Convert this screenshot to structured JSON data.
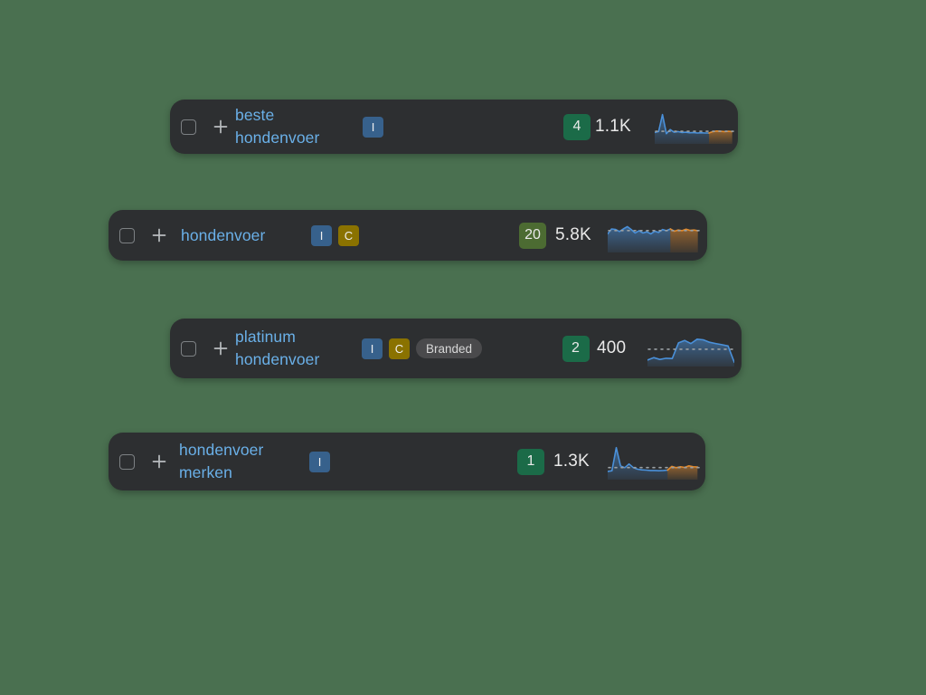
{
  "theme": {
    "page_background": "#4a7050",
    "card_background": "#2d2f31",
    "keyword_link_color": "#6ab0e8",
    "volume_text_color": "#e9e9e9",
    "intent_informational_color": "#37618c",
    "intent_commercial_color": "#8a7200",
    "branded_pill_color": "#4a4a4c",
    "count_green_dark": "#1b6b48",
    "count_green_olive": "#4c6b32",
    "spark_blue": "#4a90d9",
    "spark_orange": "#e08a2e"
  },
  "icons": {
    "checkbox": "checkbox-unchecked-icon",
    "add": "plus-icon"
  },
  "rows": [
    {
      "id": "row-beste-hondenvoer",
      "keyword": "beste\nhondenvoer",
      "checked": false,
      "intents": [
        {
          "label": "I",
          "name": "intent-informational",
          "color": "#37618c"
        }
      ],
      "branded": null,
      "count": "4",
      "count_color": "#1b6b48",
      "volume": "1.1K",
      "chart_data": {
        "type": "line",
        "title": "beste hondenvoer volume trend",
        "series": [
          {
            "name": "historic",
            "color": "#4a90d9",
            "values": [
              0.3,
              0.33,
              0.92,
              0.26,
              0.4,
              0.31,
              0.33,
              0.3,
              0.31,
              0.29,
              0.3,
              0.28,
              0.29,
              0.28,
              0.28
            ]
          },
          {
            "name": "forecast",
            "color": "#e08a2e",
            "values": [
              0.28,
              0.33,
              0.35,
              0.34,
              0.33,
              0.34,
              0.33
            ]
          }
        ],
        "ylim": [
          0,
          1
        ],
        "grid": false,
        "legend": "none",
        "dotted_baseline": true
      }
    },
    {
      "id": "row-hondenvoer",
      "keyword": "hondenvoer",
      "checked": false,
      "intents": [
        {
          "label": "I",
          "name": "intent-informational",
          "color": "#37618c"
        },
        {
          "label": "C",
          "name": "intent-commercial",
          "color": "#8a7200"
        }
      ],
      "branded": null,
      "count": "20",
      "count_color": "#4c6b32",
      "volume": "5.8K",
      "chart_data": {
        "type": "area",
        "title": "hondenvoer volume trend",
        "series": [
          {
            "name": "historic",
            "color": "#4a90d9",
            "values": [
              0.55,
              0.72,
              0.7,
              0.63,
              0.72,
              0.8,
              0.7,
              0.58,
              0.66,
              0.58,
              0.62,
              0.55,
              0.64,
              0.6,
              0.7,
              0.66,
              0.72
            ]
          },
          {
            "name": "forecast",
            "color": "#e08a2e",
            "values": [
              0.72,
              0.64,
              0.68,
              0.66,
              0.71,
              0.67,
              0.68,
              0.66
            ]
          }
        ],
        "ylim": [
          0,
          1
        ],
        "grid": false,
        "legend": "none",
        "dotted_baseline": true
      }
    },
    {
      "id": "row-platinum-hondenvoer",
      "keyword": "platinum\nhondenvoer",
      "checked": false,
      "intents": [
        {
          "label": "I",
          "name": "intent-informational",
          "color": "#37618c"
        },
        {
          "label": "C",
          "name": "intent-commercial",
          "color": "#8a7200"
        }
      ],
      "branded": "Branded",
      "count": "2",
      "count_color": "#1b6b48",
      "volume": "400",
      "chart_data": {
        "type": "area",
        "title": "platinum hondenvoer volume trend",
        "series": [
          {
            "name": "historic",
            "color": "#4a90d9",
            "values": [
              0.12,
              0.2,
              0.14,
              0.18,
              0.17,
              0.68,
              0.76,
              0.66,
              0.8,
              0.78,
              0.7,
              0.66,
              0.62,
              0.58,
              0.05
            ]
          }
        ],
        "ylim": [
          0,
          1
        ],
        "grid": false,
        "legend": "none",
        "dotted_baseline": true
      }
    },
    {
      "id": "row-hondenvoer-merken",
      "keyword": "hondenvoer\nmerken",
      "checked": false,
      "intents": [
        {
          "label": "I",
          "name": "intent-informational",
          "color": "#37618c"
        }
      ],
      "branded": null,
      "count": "1",
      "count_color": "#1b6b48",
      "volume": "1.3K",
      "chart_data": {
        "type": "area",
        "title": "hondenvoer merken volume trend",
        "series": [
          {
            "name": "historic",
            "color": "#4a90d9",
            "values": [
              0.18,
              0.2,
              0.95,
              0.36,
              0.3,
              0.42,
              0.3,
              0.25,
              0.23,
              0.22,
              0.21,
              0.21,
              0.2,
              0.21,
              0.22
            ]
          },
          {
            "name": "forecast",
            "color": "#e08a2e",
            "values": [
              0.22,
              0.34,
              0.3,
              0.33,
              0.31,
              0.36,
              0.33,
              0.32
            ]
          }
        ],
        "ylim": [
          0,
          1
        ],
        "grid": false,
        "legend": "none",
        "dotted_baseline": true
      }
    }
  ]
}
